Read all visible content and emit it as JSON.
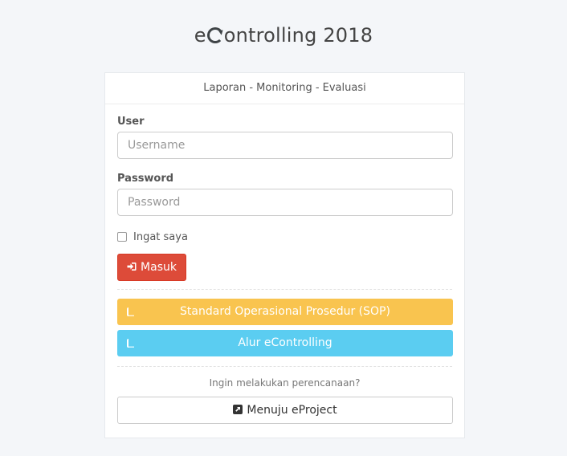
{
  "app": {
    "title_prefix": "e",
    "title_suffix": "ontrolling 2018"
  },
  "card": {
    "header": "Laporan - Monitoring - Evaluasi"
  },
  "form": {
    "user_label": "User",
    "username_placeholder": "Username",
    "username_value": "",
    "password_label": "Password",
    "password_placeholder": "Password",
    "password_value": "",
    "remember_label": "Ingat saya",
    "remember_checked": false,
    "login_label": "Masuk",
    "login_icon": "sign-in-icon"
  },
  "links": {
    "sop_label": "Standard Operasional Prosedur (SOP)",
    "alur_label": "Alur eControlling",
    "book_icon": "book-icon",
    "question": "Ingin melakukan perencanaan?",
    "project_label": "Menuju eProject",
    "project_icon": "external-link-icon"
  },
  "colors": {
    "login": "#dd4b39",
    "sop": "#f9c44f",
    "alur": "#5bcdf1",
    "background": "#f4f6f9"
  }
}
